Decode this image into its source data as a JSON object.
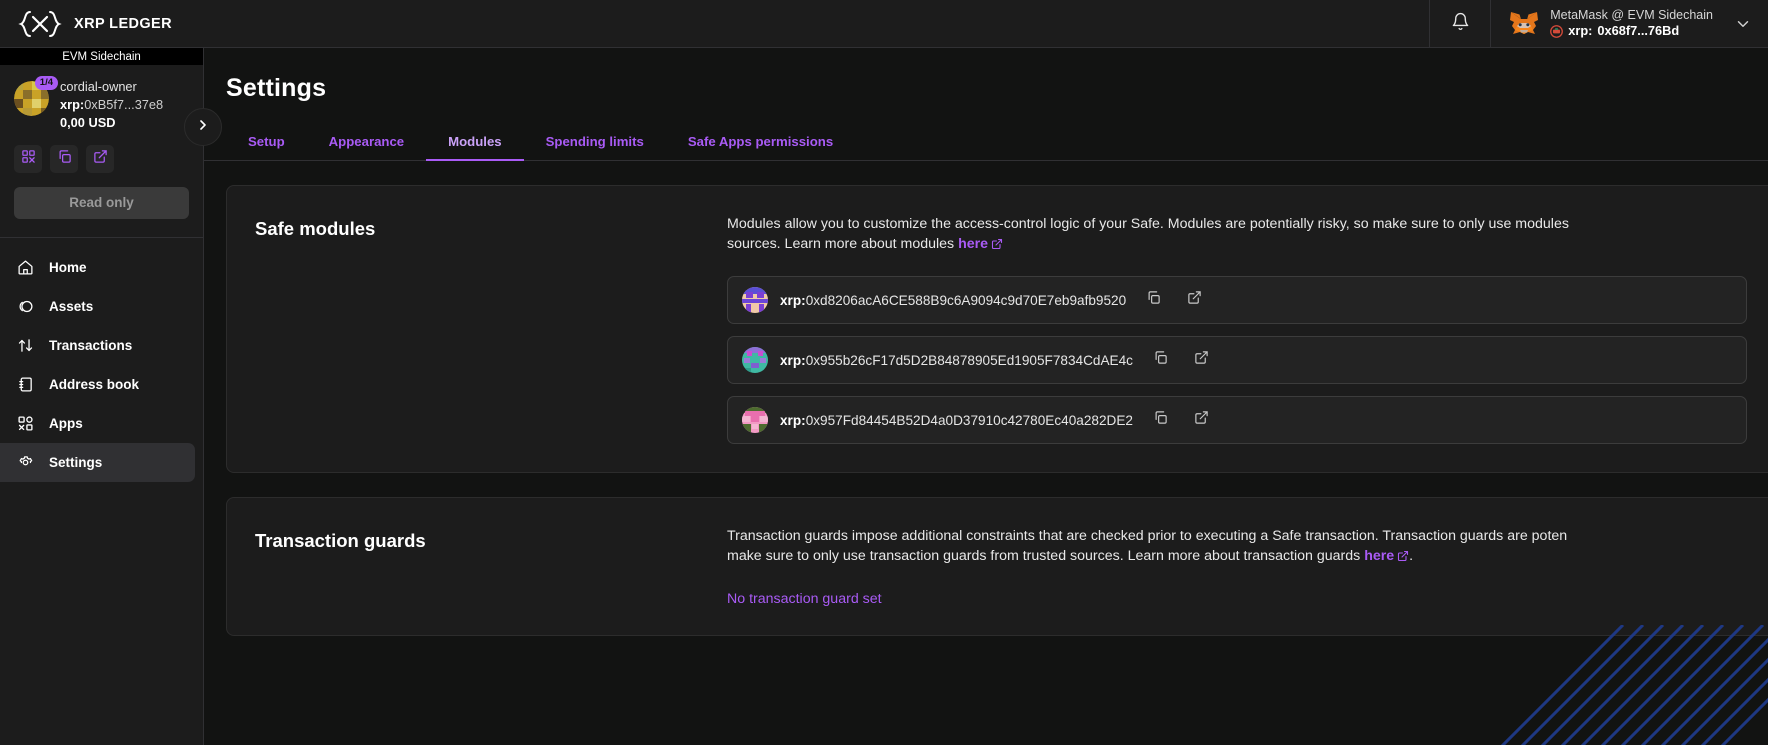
{
  "topbar": {
    "brand": "XRP LEDGER",
    "brand_logo_icon": "xrp-ledger-logo",
    "notifications_icon": "bell-icon",
    "wallet": {
      "provider_network": "MetaMask @ EVM Sidechain",
      "address_prefix": "xrp:",
      "address": "0x68f7...76Bd",
      "wallet_icon": "metamask-fox-icon",
      "chain_icon": "chain-badge-icon",
      "chevron_icon": "chevron-down-icon"
    }
  },
  "sidebar": {
    "chain_banner": "EVM Sidechain",
    "safe": {
      "name": "cordial-owner",
      "address_prefix": "xrp:",
      "address": "0xB5f7...37e8",
      "threshold": "1/4",
      "fiat_balance": "0,00 USD",
      "identicon_icon": "safe-identicon",
      "actions": [
        {
          "name": "qr-code-icon"
        },
        {
          "name": "copy-icon"
        },
        {
          "name": "external-link-icon"
        }
      ]
    },
    "readonly_label": "Read only",
    "expander_icon": "chevron-right-icon",
    "items": [
      {
        "label": "Home",
        "icon": "home-icon",
        "active": false
      },
      {
        "label": "Assets",
        "icon": "assets-icon",
        "active": false
      },
      {
        "label": "Transactions",
        "icon": "transactions-arrows-icon",
        "active": false
      },
      {
        "label": "Address book",
        "icon": "address-book-icon",
        "active": false
      },
      {
        "label": "Apps",
        "icon": "apps-grid-icon",
        "active": false
      },
      {
        "label": "Settings",
        "icon": "gear-icon",
        "active": true
      }
    ]
  },
  "main": {
    "page_title": "Settings",
    "tabs": [
      {
        "label": "Setup",
        "active": false
      },
      {
        "label": "Appearance",
        "active": false
      },
      {
        "label": "Modules",
        "active": true
      },
      {
        "label": "Spending limits",
        "active": false
      },
      {
        "label": "Safe Apps permissions",
        "active": false
      }
    ],
    "safe_modules": {
      "title": "Safe modules",
      "description_part1": "Modules allow you to customize the access-control logic of your Safe. Modules are potentially risky, so make sure to only use modules",
      "description_part2": "sources. Learn more about modules ",
      "link_label": "here",
      "link_icon": "external-link-icon",
      "modules": [
        {
          "address_prefix": "xrp:",
          "address": "0xd8206acA6CE588B9c6A9094c9d70E7eb9afb9520",
          "identicon_icon": "module-identicon",
          "copy_icon": "copy-icon",
          "explorer_icon": "external-link-icon"
        },
        {
          "address_prefix": "xrp:",
          "address": "0x955b26cF17d5D2B84878905Ed1905F7834CdAE4c",
          "identicon_icon": "module-identicon",
          "copy_icon": "copy-icon",
          "explorer_icon": "external-link-icon"
        },
        {
          "address_prefix": "xrp:",
          "address": "0x957Fd84454B52D4a0D37910c42780Ec40a282DE2",
          "identicon_icon": "module-identicon",
          "copy_icon": "copy-icon",
          "explorer_icon": "external-link-icon"
        }
      ]
    },
    "transaction_guards": {
      "title": "Transaction guards",
      "description_part1": "Transaction guards impose additional constraints that are checked prior to executing a Safe transaction. Transaction guards are poten",
      "description_part2": "make sure to only use transaction guards from trusted sources. Learn more about transaction guards ",
      "link_label": "here",
      "link_icon": "external-link-icon",
      "description_tail": ".",
      "status": "No transaction guard set"
    }
  },
  "colors": {
    "accent": "#a95bf5",
    "background": "#121312",
    "panel": "#1c1c1c",
    "border": "#303033"
  }
}
